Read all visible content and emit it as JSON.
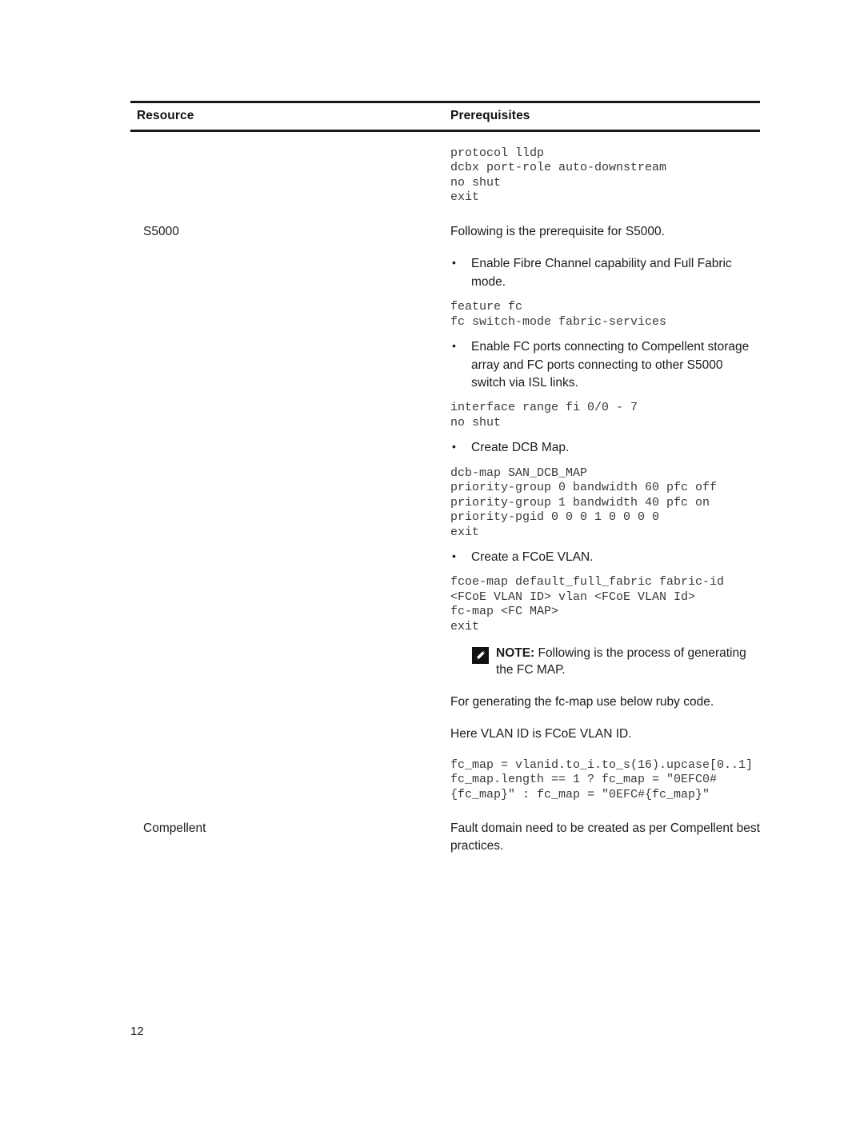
{
  "document": {
    "page_number": "12"
  },
  "table": {
    "headers": {
      "resource": "Resource",
      "prerequisites": "Prerequisites"
    },
    "continued_row": {
      "code": "protocol lldp\ndcbx port-role auto-downstream\nno shut\nexit"
    },
    "rows": [
      {
        "resource": "S5000",
        "intro": "Following is the prerequisite for S5000.",
        "items": [
          {
            "bullet": "Enable Fibre Channel capability and Full Fabric mode.",
            "code": "feature fc\nfc switch-mode fabric-services"
          },
          {
            "bullet": "Enable FC ports connecting to Compellent storage array and FC ports connecting to other S5000 switch via ISL links.",
            "code": "interface range fi 0/0 - 7\nno shut"
          },
          {
            "bullet": "Create DCB Map.",
            "code": "dcb-map SAN_DCB_MAP\npriority-group 0 bandwidth 60 pfc off\npriority-group 1 bandwidth 40 pfc on\npriority-pgid 0 0 0 1 0 0 0 0\nexit"
          },
          {
            "bullet": "Create a FCoE VLAN.",
            "code": "fcoe-map default_full_fabric fabric-id <FCoE VLAN ID> vlan <FCoE VLAN Id>\nfc-map <FC MAP>\nexit"
          }
        ],
        "note": {
          "label": "NOTE:",
          "text": " Following is the process of generating the FC MAP.",
          "icon": "pencil-note-icon"
        },
        "after_note": {
          "paragraph_1": "For generating the fc-map use below ruby code.",
          "paragraph_2": "Here VLAN ID is FCoE VLAN ID.",
          "code": "fc_map = vlanid.to_i.to_s(16).upcase[0..1]\nfc_map.length == 1 ? fc_map = \"0EFC0#{fc_map}\" : fc_map = \"0EFC#{fc_map}\""
        }
      },
      {
        "resource": "Compellent",
        "text": "Fault domain need to be created as per Compellent best practices."
      }
    ]
  }
}
